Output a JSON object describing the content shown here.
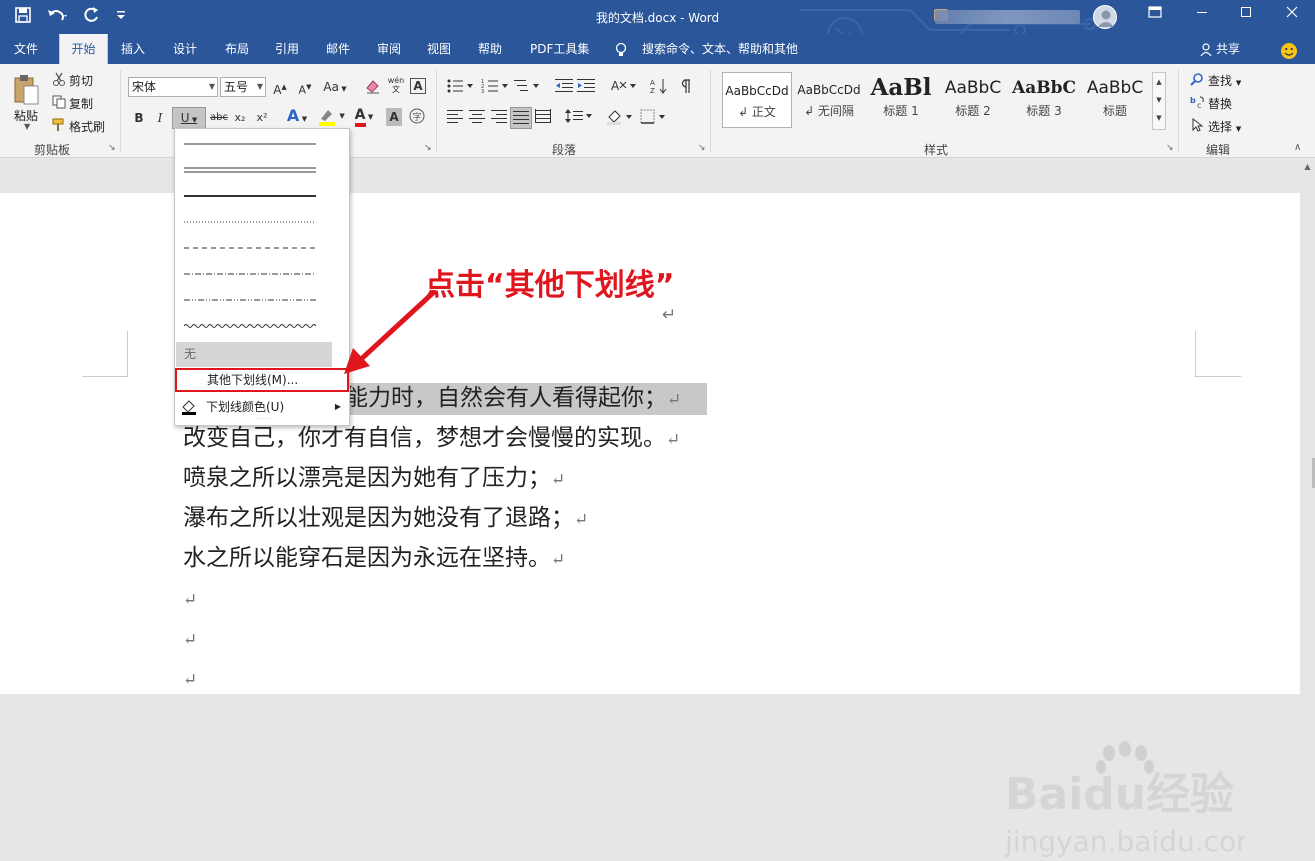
{
  "window": {
    "title": "我的文档.docx - Word"
  },
  "tabs": [
    {
      "label": "文件"
    },
    {
      "label": "开始"
    },
    {
      "label": "插入"
    },
    {
      "label": "设计"
    },
    {
      "label": "布局"
    },
    {
      "label": "引用"
    },
    {
      "label": "邮件"
    },
    {
      "label": "审阅"
    },
    {
      "label": "视图"
    },
    {
      "label": "帮助"
    },
    {
      "label": "PDF工具集"
    }
  ],
  "tell_me": "搜索命令、文本、帮助和其他",
  "share_label": "共享",
  "clipboard": {
    "paste": "粘贴",
    "cut": "剪切",
    "copy": "复制",
    "format_painter": "格式刷",
    "group_label": "剪贴板"
  },
  "font": {
    "name": "宋体",
    "size": "五号",
    "case_label": "Aa",
    "phonetic_label": "wén",
    "bold": "B",
    "italic": "I",
    "underline": "U",
    "strike": "abc",
    "sub": "x₂",
    "sup": "x²",
    "text_effects": "A",
    "font_color": "A",
    "shading": "A"
  },
  "paragraph": {
    "group_label": "段落"
  },
  "styles": {
    "items": [
      {
        "preview": "AaBbCcDd",
        "name": "↲ 正文"
      },
      {
        "preview": "AaBbCcDd",
        "name": "↲ 无间隔"
      },
      {
        "preview": "AaBl",
        "name": "标题 1"
      },
      {
        "preview": "AaBbC",
        "name": "标题 2"
      },
      {
        "preview": "AaBbC",
        "name": "标题 3"
      },
      {
        "preview": "AaBbC",
        "name": "标题"
      }
    ],
    "group_label": "样式"
  },
  "editing": {
    "find": "查找",
    "replace": "替换",
    "select": "选择",
    "group_label": "编辑"
  },
  "underline_menu": {
    "none_label": "无",
    "more_label": "其他下划线(M)...",
    "color_label": "下划线颜色(U)"
  },
  "document": {
    "lines": [
      "能力时，自然会有人看得起你；",
      "改变自己，你才有自信，梦想才会慢慢的实现。",
      "喷泉之所以漂亮是因为她有了压力；",
      "瀑布之所以壮观是因为她没有了退路；",
      "水之所以能穿石是因为永远在坚持。"
    ],
    "return_mark": "↵"
  },
  "annotation": "点击“其他下划线”",
  "watermark": {
    "brand": "Baidu经验",
    "url": "jingyan.baidu.com"
  },
  "colors": {
    "ribbon_blue": "#2b579a",
    "highlight": "#e0161f",
    "selection": "#c8c8c8"
  }
}
